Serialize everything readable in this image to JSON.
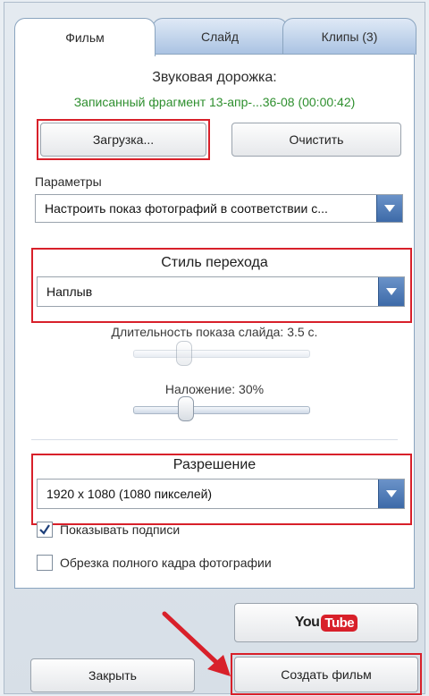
{
  "tabs": [
    {
      "label": "Фильм"
    },
    {
      "label": "Слайд"
    },
    {
      "label": "Клипы (3)"
    }
  ],
  "sound": {
    "title": "Звуковая дорожка:",
    "file": "Записанный фрагмент 13-апр-...36-08 (00:00:42)",
    "load_label": "Загрузка...",
    "clear_label": "Очистить"
  },
  "params": {
    "label": "Параметры",
    "value": "Настроить показ фотографий в соответствии с..."
  },
  "transition": {
    "label": "Стиль перехода",
    "value": "Наплыв"
  },
  "slide_duration": {
    "label": "Длительность показа слайда: 3.5 с.",
    "value_seconds": 3.5
  },
  "overlap": {
    "label": "Наложение: 30%",
    "value_percent": 30
  },
  "resolution": {
    "label": "Разрешение",
    "value": "1920 x 1080 (1080 пикселей)"
  },
  "options": {
    "show_captions_label": "Показывать подписи",
    "show_captions_checked": true,
    "crop_label": "Обрезка полного кадра фотографии",
    "crop_checked": false
  },
  "youtube": {
    "you": "You",
    "tube": "Tube"
  },
  "footer": {
    "close_label": "Закрыть",
    "create_label": "Создать фильм"
  },
  "colors": {
    "highlight": "#d8202a",
    "file_text": "#2e8f2e",
    "dropdown": "#3d6aa8"
  }
}
